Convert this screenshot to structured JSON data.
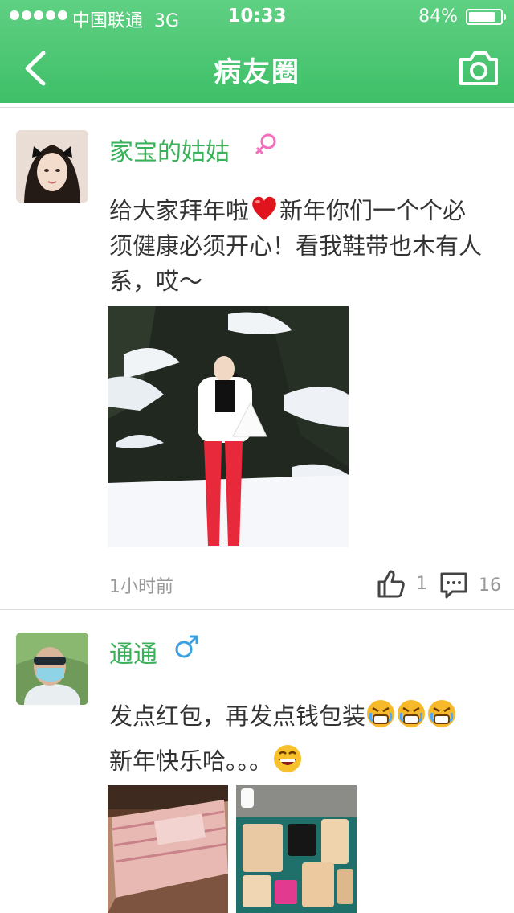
{
  "status_bar": {
    "carrier": "中国联通",
    "network": "3G",
    "time": "10:33",
    "battery_percent": "84%",
    "battery_level": 0.84
  },
  "nav": {
    "title": "病友圈",
    "back_icon": "chevron-left-icon",
    "camera_icon": "camera-icon"
  },
  "colors": {
    "brand_green": "#44c26c",
    "username_green": "#3bb25a",
    "female": "#f36fbd",
    "male": "#3aa0e0",
    "muted": "#999999"
  },
  "posts": [
    {
      "username": "家宝的姑姑",
      "gender": "female",
      "text_before_emoji": "给大家拜年啦",
      "emoji": "heart-icon",
      "text_after_emoji": "新年你们一个个必须健康必须开心！看我鞋带也木有人系，哎～",
      "photo": "snow-portrait-photo",
      "time_ago": "1小时前",
      "likes": "1",
      "comments": "16"
    },
    {
      "username": "通通",
      "gender": "male",
      "text_before_emoji": "发点红包，再发点钱包装",
      "emoji_row": [
        "crying-face-icon",
        "crying-face-icon",
        "crying-face-icon"
      ],
      "text_line2": "新年快乐哈。。。",
      "emoji_end": "laughing-face-icon",
      "photos": [
        "banknotes-photo",
        "leather-wallets-photo"
      ]
    }
  ]
}
